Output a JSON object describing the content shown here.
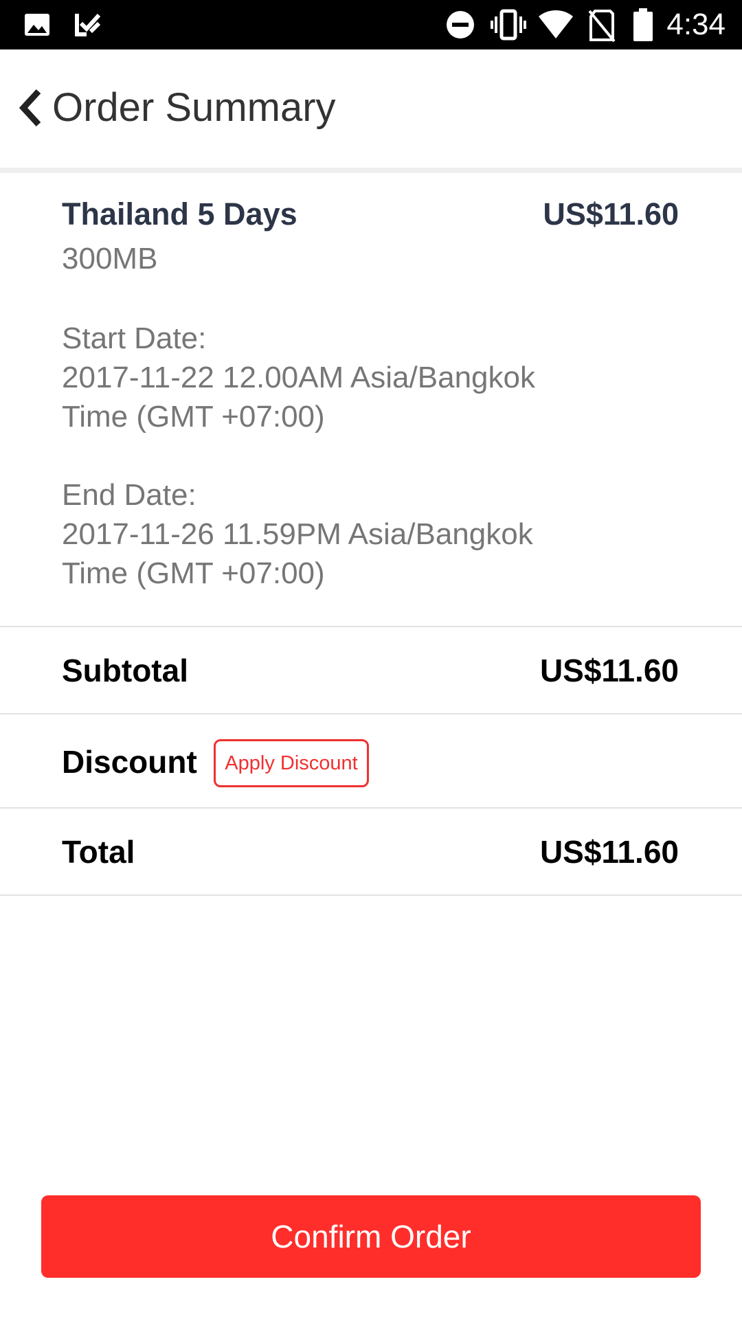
{
  "status_bar": {
    "time": "4:34",
    "icons": [
      "image-icon",
      "checklist-icon",
      "do-not-disturb-icon",
      "vibrate-icon",
      "wifi-icon",
      "no-sim-icon",
      "battery-icon"
    ]
  },
  "header": {
    "back_icon": "chevron-left-icon",
    "title": "Order Summary"
  },
  "order_item": {
    "name": "Thailand 5 Days",
    "price": "US$11.60",
    "data_allowance": "300MB",
    "start_date": {
      "label": "Start Date:",
      "line1": "2017-11-22 12.00AM Asia/Bangkok",
      "line2": "Time (GMT +07:00)"
    },
    "end_date": {
      "label": "End Date:",
      "line1": "2017-11-26 11.59PM Asia/Bangkok",
      "line2": "Time (GMT +07:00)"
    }
  },
  "summary": {
    "subtotal_label": "Subtotal",
    "subtotal_value": "US$11.60",
    "discount_label": "Discount",
    "apply_discount_label": "Apply Discount",
    "total_label": "Total",
    "total_value": "US$11.60"
  },
  "actions": {
    "confirm_label": "Confirm Order"
  },
  "colors": {
    "accent": "#ff2e2b",
    "title_text": "#2d3548",
    "secondary_text": "#767676"
  }
}
